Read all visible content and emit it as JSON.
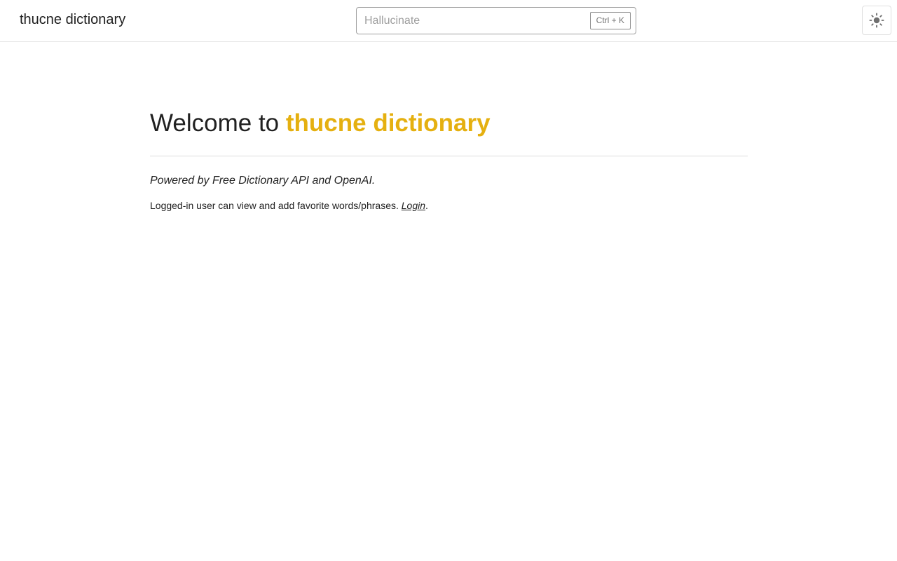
{
  "header": {
    "brand": "thucne dictionary",
    "search": {
      "value": "",
      "placeholder": "Hallucinate",
      "shortcut": "Ctrl + K"
    },
    "theme_toggle_icon": "sun-icon"
  },
  "main": {
    "title_prefix": "Welcome to ",
    "title_highlight": "thucne dictionary",
    "powered_by": "Powered by Free Dictionary API and OpenAI.",
    "note_text": "Logged-in user can view and add favorite words/phrases. ",
    "login_link": "Login",
    "note_suffix": "."
  },
  "colors": {
    "accent": "#e5b010",
    "text": "#212121",
    "border": "#e3e3e3"
  }
}
